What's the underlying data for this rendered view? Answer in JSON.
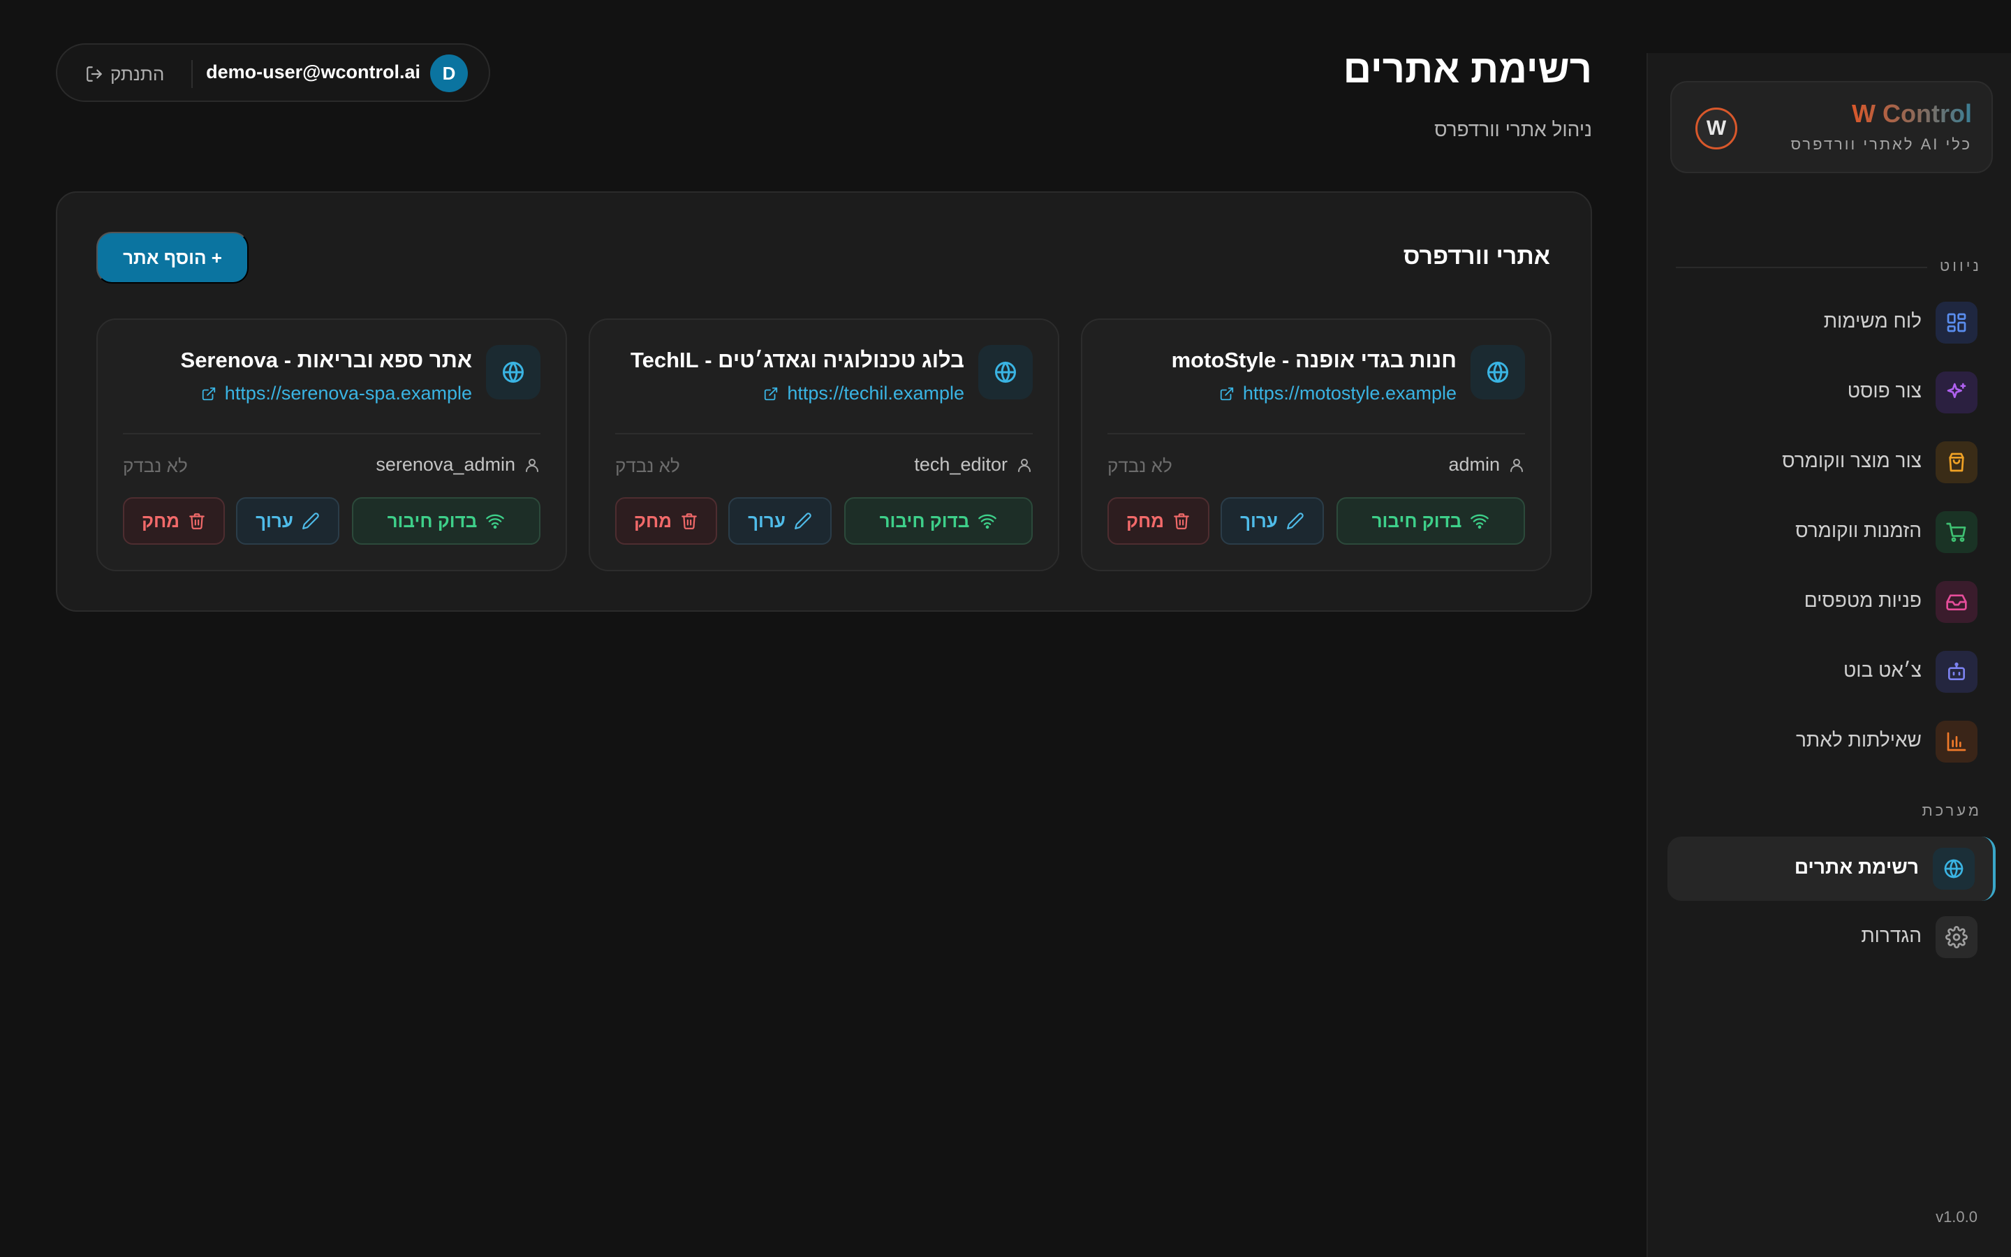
{
  "brand": {
    "title": "W Control",
    "subtitle": "כלי AI לאתרי וורדפרס",
    "logo_letter": "W"
  },
  "sidebar": {
    "sections": {
      "navigation": "ניווט",
      "system": "מערכת"
    },
    "items": [
      {
        "label": "לוח משימות",
        "icon": "dashboard-icon",
        "color": "#5a8dee",
        "bg": "#1f2740"
      },
      {
        "label": "צור פוסט",
        "icon": "sparkles-icon",
        "color": "#b061f0",
        "bg": "#2b2040"
      },
      {
        "label": "צור מוצר ווקומרס",
        "icon": "shopping-bag-icon",
        "color": "#f0a225",
        "bg": "#3a2c17"
      },
      {
        "label": "הזמנות ווקומרס",
        "icon": "shopping-cart-icon",
        "color": "#3ec072",
        "bg": "#1a3325"
      },
      {
        "label": "פניות מטפסים",
        "icon": "inbox-icon",
        "color": "#e64d9a",
        "bg": "#3a1c2c"
      },
      {
        "label": "צ׳אט בוט",
        "icon": "bot-icon",
        "color": "#7c82f0",
        "bg": "#24263f"
      },
      {
        "label": "שאילתות לאתר",
        "icon": "bar-chart-icon",
        "color": "#f07a2a",
        "bg": "#3a2518"
      },
      {
        "label": "רשימת אתרים",
        "icon": "globe-icon",
        "color": "#3ab4e3",
        "bg": "#1b2f38",
        "active": true
      },
      {
        "label": "הגדרות",
        "icon": "gear-icon",
        "color": "#a0a0a0",
        "bg": "#2a2a2a"
      }
    ],
    "version": "v1.0.0"
  },
  "header": {
    "title": "רשימת אתרים",
    "subtitle": "ניהול אתרי וורדפרס",
    "user": {
      "avatar_letter": "D",
      "email": "demo-user@wcontrol.ai",
      "logout_label": "התנתק"
    }
  },
  "main": {
    "panel_title": "אתרי וורדפרס",
    "add_button": "+ הוסף אתר",
    "sites": [
      {
        "name": "חנות בגדי אופנה - motoStyle",
        "url": "https://motostyle.example",
        "user": "admin",
        "status": "לא נבדק"
      },
      {
        "name": "בלוג טכנולוגיה וגאדג׳טים - TechIL",
        "url": "https://techil.example",
        "user": "tech_editor",
        "status": "לא נבדק"
      },
      {
        "name": "אתר ספא ובריאות - Serenova",
        "url": "https://serenova-spa.example",
        "user": "serenova_admin",
        "status": "לא נבדק"
      }
    ],
    "buttons": {
      "test": "בדוק חיבור",
      "edit": "ערוך",
      "delete": "מחק"
    }
  },
  "colors": {
    "accent": "#0b74a0",
    "link": "#3ab4e3",
    "success": "#3ed08a",
    "danger": "#f26a6a"
  }
}
